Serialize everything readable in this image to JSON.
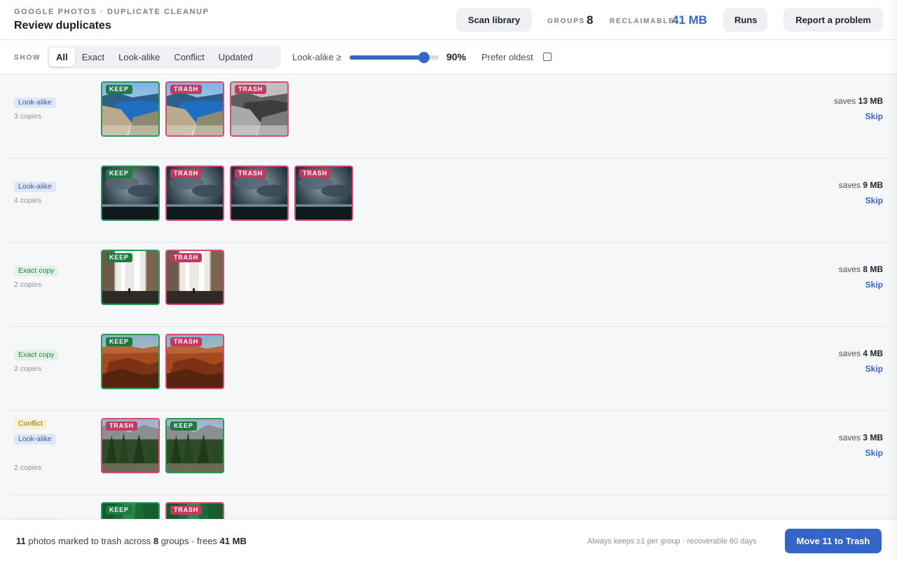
{
  "header": {
    "eyebrow": "GOOGLE PHOTOS · DUPLICATE CLEANUP",
    "title": "Review duplicates",
    "scan_label": "Scan library",
    "groups_label": "GROUPS",
    "groups_value": "8",
    "reclaimable_label": "RECLAIMABLE",
    "reclaimable_value": "41 MB",
    "runs_label": "Runs",
    "report_label": "Report a problem"
  },
  "filters": {
    "show_label": "SHOW",
    "segments": [
      "All",
      "Exact",
      "Look-alike",
      "Conflict",
      "Updated"
    ],
    "active_segment": "All",
    "slider_label": "Look-alike ≥",
    "slider_value": 90,
    "slider_value_text": "90%",
    "prefer_label": "Prefer oldest",
    "prefer_checked": false
  },
  "groups": [
    {
      "badges": [
        {
          "kind": "lookalike",
          "text": "Look-alike"
        }
      ],
      "copies": "3 copies",
      "saves_prefix": "saves",
      "saves_value": "13 MB",
      "skip": "Skip",
      "photos": [
        {
          "status": "keep",
          "tag": "KEEP",
          "scene": "fjord"
        },
        {
          "status": "trash",
          "tag": "TRASH",
          "scene": "fjord"
        },
        {
          "status": "trash",
          "tag": "TRASH",
          "scene": "fjord-gray"
        }
      ]
    },
    {
      "badges": [
        {
          "kind": "lookalike",
          "text": "Look-alike"
        }
      ],
      "copies": "4 copies",
      "saves_prefix": "saves",
      "saves_value": "9 MB",
      "skip": "Skip",
      "photos": [
        {
          "status": "keep",
          "tag": "KEEP",
          "scene": "storm"
        },
        {
          "status": "trash",
          "tag": "TRASH",
          "scene": "storm"
        },
        {
          "status": "trash",
          "tag": "TRASH",
          "scene": "storm"
        },
        {
          "status": "trash",
          "tag": "TRASH",
          "scene": "storm"
        }
      ]
    },
    {
      "badges": [
        {
          "kind": "exact",
          "text": "Exact copy"
        }
      ],
      "copies": "2 copies",
      "saves_prefix": "saves",
      "saves_value": "8 MB",
      "skip": "Skip",
      "photos": [
        {
          "status": "keep",
          "tag": "KEEP",
          "scene": "waterfall"
        },
        {
          "status": "trash",
          "tag": "TRASH",
          "scene": "waterfall"
        }
      ]
    },
    {
      "badges": [
        {
          "kind": "exact",
          "text": "Exact copy"
        }
      ],
      "copies": "2 copies",
      "saves_prefix": "saves",
      "saves_value": "4 MB",
      "skip": "Skip",
      "photos": [
        {
          "status": "keep",
          "tag": "KEEP",
          "scene": "canyon"
        },
        {
          "status": "trash",
          "tag": "TRASH",
          "scene": "canyon"
        }
      ]
    },
    {
      "badges": [
        {
          "kind": "conflict",
          "text": "Conflict"
        },
        {
          "kind": "lookalike",
          "text": "Look-alike"
        }
      ],
      "copies": "2 copies",
      "saves_prefix": "saves",
      "saves_value": "3 MB",
      "skip": "Skip",
      "photos": [
        {
          "status": "trash",
          "tag": "TRASH",
          "scene": "valley"
        },
        {
          "status": "keep",
          "tag": "KEEP",
          "scene": "valley"
        }
      ]
    },
    {
      "badges": [
        {
          "kind": "lookalike",
          "text": ""
        }
      ],
      "copies": "",
      "saves_prefix": "",
      "saves_value": "",
      "skip": "",
      "photos": [
        {
          "status": "keep",
          "tag": "KEEP",
          "scene": "forest"
        },
        {
          "status": "trash",
          "tag": "TRASH",
          "scene": "forest"
        }
      ]
    }
  ],
  "footer": {
    "count": "11",
    "text1": "photos marked to trash across",
    "groups": "8",
    "text2": "groups · frees",
    "size": "41 MB",
    "note": "Always keeps ≥1 per group · recoverable 60 days",
    "action_label": "Move 11 to Trash"
  }
}
